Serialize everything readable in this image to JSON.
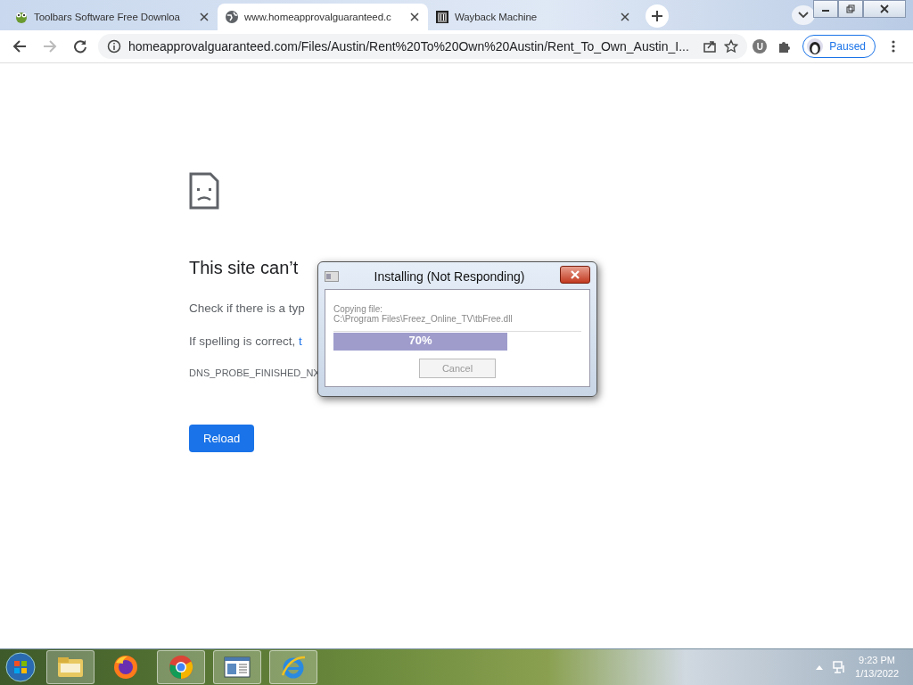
{
  "tabs": [
    {
      "title": "Toolbars Software Free Downloa",
      "selected": false,
      "kind": "frog"
    },
    {
      "title": "www.homeapprovalguaranteed.c",
      "selected": true,
      "kind": "globe"
    },
    {
      "title": "Wayback Machine",
      "selected": false,
      "kind": "museum"
    }
  ],
  "toolbar": {
    "url": "homeapprovalguaranteed.com/Files/Austin/Rent%20To%20Own%20Austin/Rent_To_Own_Austin_I...",
    "extension_badge": "U",
    "profile": "Paused"
  },
  "error_page": {
    "heading": "This site can’t",
    "line_1": "Check if there is a typ",
    "line_2": "If spelling is correct, ",
    "line_2_link": "t",
    "error_code": "DNS_PROBE_FINISHED_NX",
    "reload_button": "Reload"
  },
  "dialog": {
    "title": "Installing (Not Responding)",
    "label": "Copying file:",
    "path": "C:\\Program Files\\Freez_Online_TV\\tbFree.dll",
    "progress_text": "70%",
    "level": 0.7,
    "cancel_button": "Cancel"
  },
  "taskbar": {
    "apps": [
      {
        "kind": "folder"
      },
      {
        "kind": "firefox"
      },
      {
        "kind": "chrome"
      },
      {
        "kind": "window"
      },
      {
        "kind": "ie"
      }
    ],
    "time": "9:23 PM",
    "date": "1/13/2022"
  }
}
